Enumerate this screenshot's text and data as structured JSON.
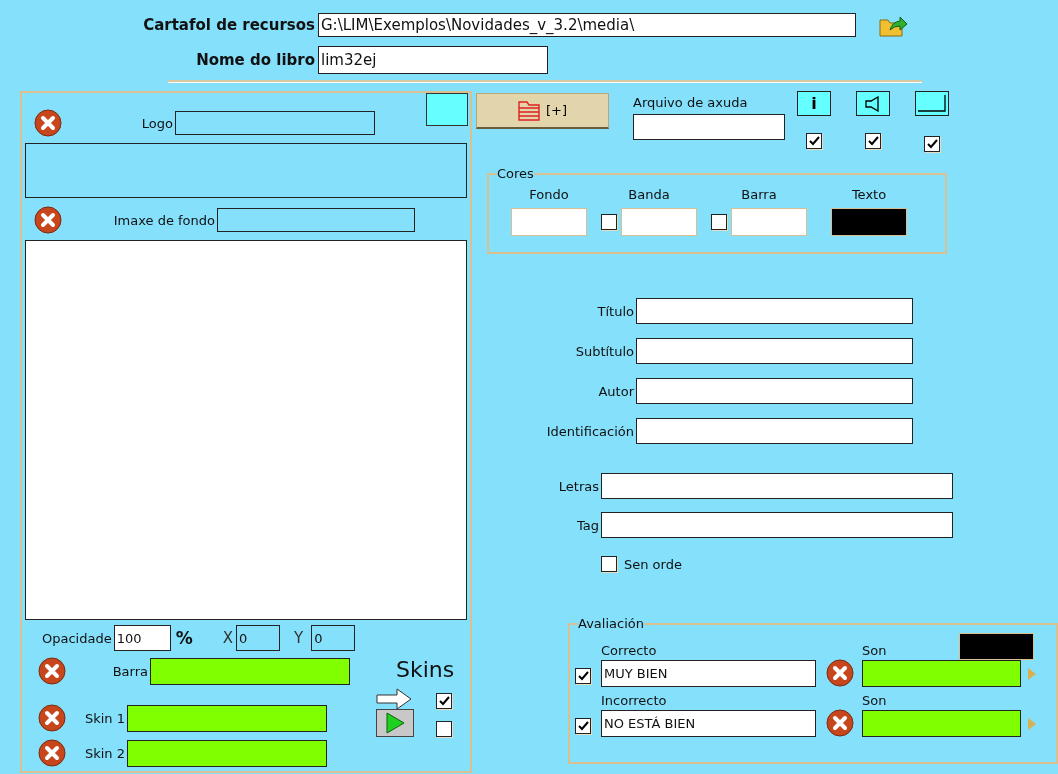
{
  "header": {
    "resource_folder": {
      "label": "Cartafol de recursos",
      "value": "G:\\LIM\\Exemplos\\Novidades_v_3.2\\media\\"
    },
    "book_name": {
      "label": "Nome do libro",
      "value": "lim32ej"
    }
  },
  "left_panel": {
    "logo": {
      "label": "Logo",
      "color": "#66ffff"
    },
    "background_image": {
      "label": "Imaxe de fondo"
    },
    "opacity": {
      "label": "Opacidade",
      "value": "100",
      "unit": "%"
    },
    "x": {
      "label": "X",
      "value": "0"
    },
    "y": {
      "label": "Y",
      "value": "0"
    },
    "skins_title": "Skins",
    "skin_rows": [
      {
        "kind": "bar",
        "label": "Barra"
      },
      {
        "kind": "arrow",
        "label": "Skin 1",
        "checked": true
      },
      {
        "kind": "play",
        "label": "Skin 2",
        "checked": false
      }
    ]
  },
  "toolbar": {
    "add_button": "[+]",
    "help_file": {
      "label": "Arquivo de axuda"
    },
    "toggles": [
      {
        "kind": "info",
        "label": "i",
        "checked": true
      },
      {
        "kind": "sound",
        "checked": true
      },
      {
        "kind": "window",
        "checked": true
      }
    ]
  },
  "colors": {
    "title": "Cores",
    "items": [
      {
        "label": "Fondo",
        "color": "#ffffff"
      },
      {
        "label": "Banda",
        "color": "#ffffff",
        "checked": false
      },
      {
        "label": "Barra",
        "color": "#ffffff",
        "checked": false
      },
      {
        "label": "Texto",
        "color": "#000000"
      }
    ]
  },
  "info_fields": [
    {
      "label": "Título"
    },
    {
      "label": "Subtítulo"
    },
    {
      "label": "Autor"
    },
    {
      "label": "Identificación"
    }
  ],
  "extra_fields": [
    {
      "label": "Letras"
    },
    {
      "label": "Tag"
    }
  ],
  "no_order": {
    "label": "Sen orde",
    "checked": false
  },
  "evaluation": {
    "title": "Avaliación",
    "color": "#000000",
    "rows": [
      {
        "label": "Correcto",
        "checked": true,
        "value": "MUY BIEN",
        "sound_label": "Son"
      },
      {
        "label": "Incorrecto",
        "checked": true,
        "value": "NO ESTÁ BIEN",
        "sound_label": "Son"
      }
    ]
  }
}
